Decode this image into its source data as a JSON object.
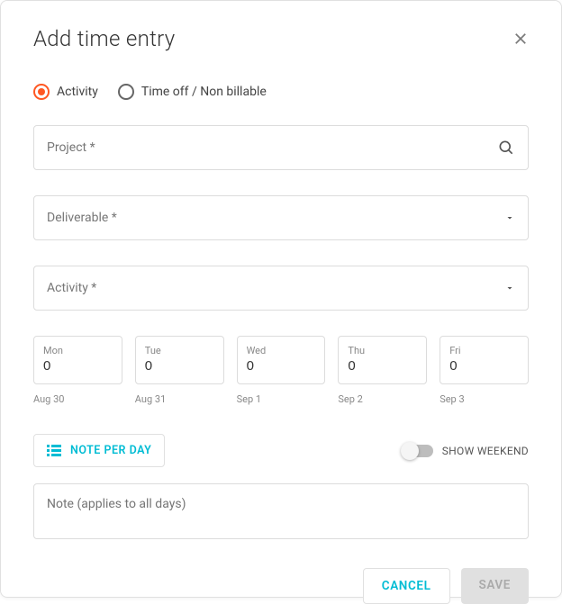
{
  "header": {
    "title": "Add time entry"
  },
  "type_radio": {
    "options": [
      {
        "label": "Activity",
        "selected": true
      },
      {
        "label": "Time off / Non billable",
        "selected": false
      }
    ]
  },
  "fields": {
    "project_label": "Project *",
    "deliverable_label": "Deliverable *",
    "activity_label": "Activity *"
  },
  "days": [
    {
      "label": "Mon",
      "value": "0",
      "date": "Aug 30"
    },
    {
      "label": "Tue",
      "value": "0",
      "date": "Aug 31"
    },
    {
      "label": "Wed",
      "value": "0",
      "date": "Sep 1"
    },
    {
      "label": "Thu",
      "value": "0",
      "date": "Sep 2"
    },
    {
      "label": "Fri",
      "value": "0",
      "date": "Sep 3"
    }
  ],
  "controls": {
    "note_per_day_label": "NOTE PER DAY",
    "show_weekend_label": "SHOW WEEKEND"
  },
  "note": {
    "placeholder": "Note (applies to all days)"
  },
  "footer": {
    "cancel_label": "CANCEL",
    "save_label": "SAVE"
  }
}
